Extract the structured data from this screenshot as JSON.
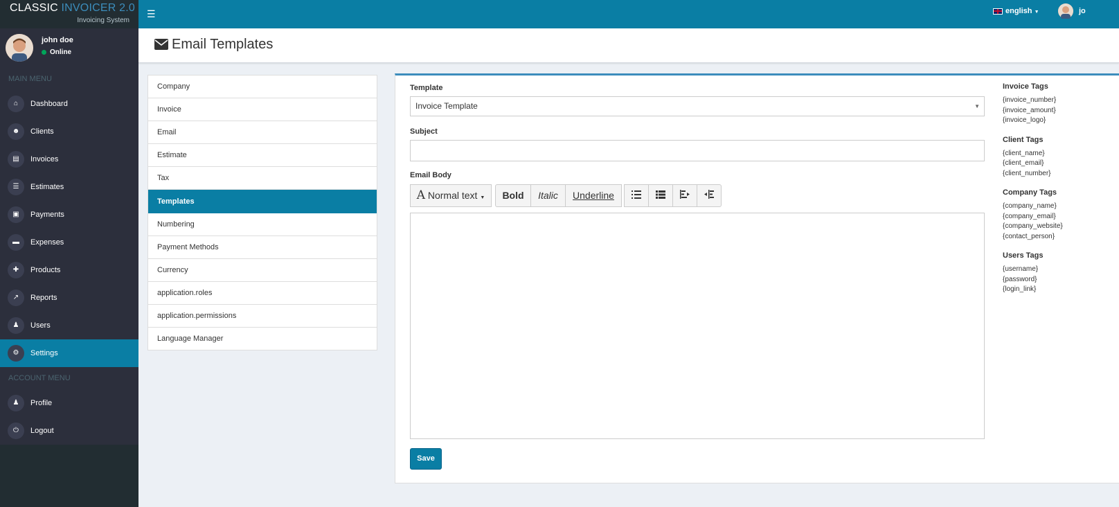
{
  "brand": {
    "name_plain": "CLASSIC",
    "name_accent": "INVOICER 2.0",
    "subtitle": "Invoicing System"
  },
  "user": {
    "name": "john doe",
    "status": "Online"
  },
  "menu": {
    "main_header": "MAIN MENU",
    "items": [
      {
        "label": "Dashboard",
        "icon": "home-icon",
        "glyph": "⌂"
      },
      {
        "label": "Clients",
        "icon": "users-icon",
        "glyph": "☻"
      },
      {
        "label": "Invoices",
        "icon": "file-pdf-icon",
        "glyph": "▤"
      },
      {
        "label": "Estimates",
        "icon": "list-icon",
        "glyph": "☰"
      },
      {
        "label": "Payments",
        "icon": "money-icon",
        "glyph": "▣"
      },
      {
        "label": "Expenses",
        "icon": "credit-card-icon",
        "glyph": "▬"
      },
      {
        "label": "Products",
        "icon": "puzzle-icon",
        "glyph": "✚"
      },
      {
        "label": "Reports",
        "icon": "chart-line-icon",
        "glyph": "↗"
      },
      {
        "label": "Users",
        "icon": "user-icon",
        "glyph": "♟"
      },
      {
        "label": "Settings",
        "icon": "cogs-icon",
        "glyph": "⚙"
      }
    ],
    "account_header": "ACCOUNT MENU",
    "account_items": [
      {
        "label": "Profile",
        "icon": "user-profile-icon",
        "glyph": "♟"
      },
      {
        "label": "Logout",
        "icon": "power-icon",
        "glyph": "⏻"
      }
    ]
  },
  "topbar": {
    "language": "english",
    "user_short": "jo"
  },
  "page": {
    "title": "Email Templates"
  },
  "settings_nav": [
    "Company",
    "Invoice",
    "Email",
    "Estimate",
    "Tax",
    "Templates",
    "Numbering",
    "Payment Methods",
    "Currency",
    "application.roles",
    "application.permissions",
    "Language Manager"
  ],
  "form": {
    "template_label": "Template",
    "template_value": "Invoice Template",
    "subject_label": "Subject",
    "subject_value": "",
    "body_label": "Email Body",
    "toolbar": {
      "normal_text": "Normal text",
      "bold": "Bold",
      "italic": "Italic",
      "underline": "Underline"
    },
    "save": "Save"
  },
  "tags": [
    {
      "title": "Invoice Tags",
      "items": [
        "{invoice_number}",
        "{invoice_amount}",
        "{invoice_logo}"
      ]
    },
    {
      "title": "Client Tags",
      "items": [
        "{client_name}",
        "{client_email}",
        "{client_number}"
      ]
    },
    {
      "title": "Company Tags",
      "items": [
        "{company_name}",
        "{company_email}",
        "{company_website}",
        "{contact_person}"
      ]
    },
    {
      "title": "Users Tags",
      "items": [
        "{username}",
        "{password}",
        "{login_link}"
      ]
    }
  ],
  "colors": {
    "accent": "#0a7ea4",
    "sidebar": "#2c2f3c",
    "online": "#00a65a"
  }
}
